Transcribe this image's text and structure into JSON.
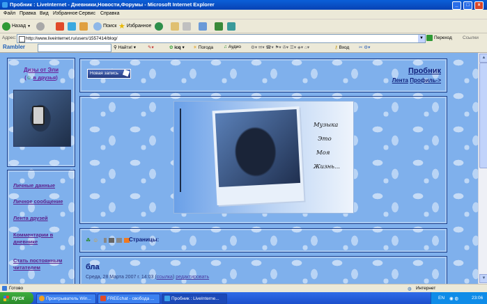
{
  "window": {
    "title": "Пробник : LiveInternet - Дневники,Новости,Форумы - Microsoft Internet Explorer",
    "minimize": "_",
    "maximize": "□",
    "close": "×"
  },
  "menu": [
    "Файл",
    "Правка",
    "Вид",
    "Избранное",
    "Сервис",
    "Справка"
  ],
  "toolbar": {
    "back": "Назад",
    "search": "Поиск",
    "favorites": "Избранное"
  },
  "address": {
    "label": "Адрес:",
    "url": "http://www.liveinternet.ru/users/1557414/blog/",
    "go": "Переход",
    "links": "Ссылки"
  },
  "rambler": {
    "logo": "Rambler",
    "find": "Найти!",
    "icq": "icq",
    "weather": "Погода",
    "audio": "Аудио",
    "login": "Вход"
  },
  "page": {
    "sidebar": {
      "username": "Дизы от Эли",
      "add_friend_prefix": "(",
      "add_friend": "в друзья",
      "add_friend_suffix": ")",
      "links": [
        "Личные данные",
        "Личное сообщение",
        "Лента друзей",
        "Комментарии в дневнике",
        "Стать постоянным читателем"
      ]
    },
    "header": {
      "new_post_button": "Новая запись",
      "blog_title": "Пробник",
      "feed_link": "Лента",
      "profile_link": "Профиль",
      "profile_arrow": "->"
    },
    "banner": {
      "lines": [
        "Музыка",
        "Это",
        "Моя",
        "Жизнь..."
      ]
    },
    "pages_label": "Страницы:",
    "post": {
      "title": "бла",
      "date": "Среда, 28 Марта 2007 г. 14:03",
      "link_open": "(",
      "link": "ссылка",
      "link_close": ")",
      "edit": "редактировать"
    }
  },
  "status": {
    "text": "Готово",
    "zone": "Интернет"
  },
  "taskbar": {
    "start": "пуск",
    "tasks": [
      "Проигрыватель Win...",
      "FREEchat - свобода ...",
      "Пробник : LiveInterne..."
    ],
    "lang": "EN",
    "clock": "23:06"
  },
  "colors": {
    "page_background": "#7fb0ec",
    "title_text": "#0f1f7a",
    "link_purple": "#5a1f8c"
  }
}
